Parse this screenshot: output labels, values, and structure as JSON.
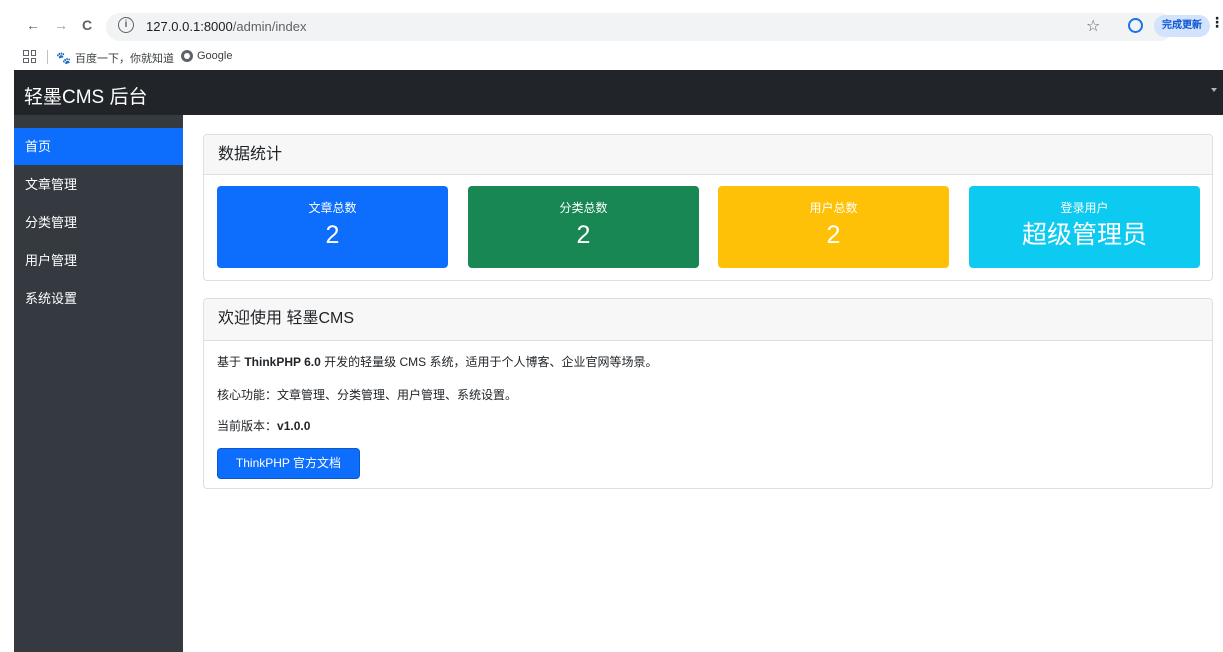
{
  "browser": {
    "url_host": "127.0.0.1:8000",
    "url_path": "/admin/index",
    "update_label": "完成更新",
    "bookmarks": [
      {
        "label": "百度一下，你就知道"
      },
      {
        "label": "Google"
      }
    ]
  },
  "app": {
    "brand": "轻墨CMS 后台"
  },
  "sidebar": {
    "items": [
      {
        "label": "首页",
        "active": true
      },
      {
        "label": "文章管理"
      },
      {
        "label": "分类管理"
      },
      {
        "label": "用户管理"
      },
      {
        "label": "系统设置"
      }
    ]
  },
  "stats": {
    "title": "数据统计",
    "cards": [
      {
        "label": "文章总数",
        "value": "2",
        "color": "#0d6efd"
      },
      {
        "label": "分类总数",
        "value": "2",
        "color": "#198754"
      },
      {
        "label": "用户总数",
        "value": "2",
        "color": "#ffc107"
      },
      {
        "label": "登录用户",
        "value": "超级管理员",
        "color": "#0dcaf0"
      }
    ]
  },
  "welcome": {
    "title": "欢迎使用 轻墨CMS",
    "line1_prefix": "基于 ",
    "line1_bold": "ThinkPHP 6.0",
    "line1_suffix": " 开发的轻量级 CMS 系统，适用于个人博客、企业官网等场景。",
    "line2": "核心功能：文章管理、分类管理、用户管理、系统设置。",
    "version_label": "当前版本：",
    "version_value": "v1.0.0",
    "doc_button": "ThinkPHP 官方文档"
  }
}
